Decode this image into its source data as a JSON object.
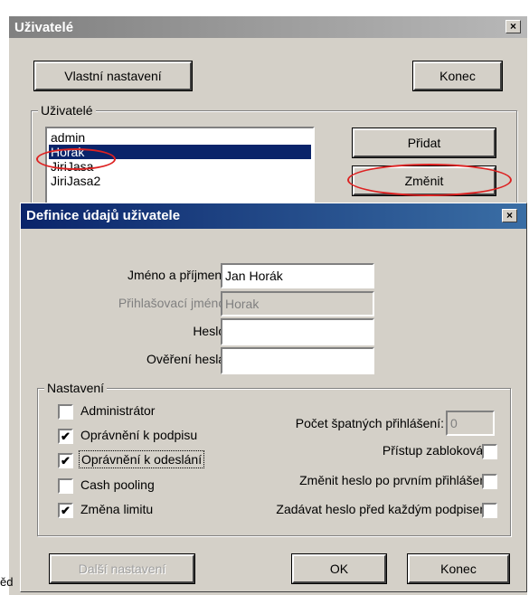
{
  "main_window": {
    "title": "Uživatelé",
    "close_glyph": "×",
    "custom_settings_button": "Vlastní nastavení",
    "end_button": "Konec",
    "users_group_label": "Uživatelé",
    "users": [
      "admin",
      "Horak",
      "JiriJasa",
      "JiriJasa2"
    ],
    "selected_user_index": 1,
    "add_button": "Přidat",
    "change_button": "Změnit"
  },
  "dialog": {
    "title": "Definice údajů uživatele",
    "close_glyph": "×",
    "fields": {
      "fullname_label": "Jméno a příjmení:",
      "fullname_value": "Jan Horák",
      "login_label": "Přihlašovací jméno:",
      "login_value": "Horak",
      "password_label": "Heslo:",
      "password_value": "",
      "password_confirm_label": "Ověření hesla:",
      "password_confirm_value": ""
    },
    "settings_group_label": "Nastavení",
    "checkboxes_left": [
      {
        "label": "Administrátor",
        "checked": false
      },
      {
        "label": "Oprávnění k podpisu",
        "checked": true
      },
      {
        "label": "Oprávnění k odeslání",
        "checked": true
      },
      {
        "label": "Cash pooling",
        "checked": false
      },
      {
        "label": "Změna limitu",
        "checked": true
      }
    ],
    "failed_logins_label": "Počet špatných přihlášení:",
    "failed_logins_value": "0",
    "checkboxes_right": [
      {
        "label": "Přístup zablokován",
        "checked": false
      },
      {
        "label": "Změnit heslo po prvním přihlášení",
        "checked": false
      },
      {
        "label": "Zadávat heslo před každým podpisem",
        "checked": false
      }
    ],
    "more_settings_button": "Další nastavení",
    "ok_button": "OK",
    "end_button": "Konec",
    "check_glyph": "✔"
  },
  "background_fragment": "ěd",
  "colors": {
    "titlebar_active": "#0a246a",
    "titlebar_inactive": "#808080",
    "face": "#d4d0c8",
    "annotation": "#dd2222"
  }
}
